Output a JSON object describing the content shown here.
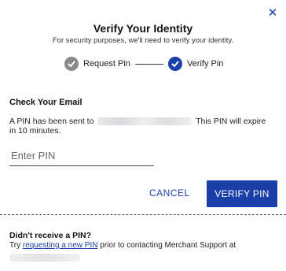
{
  "dialog": {
    "title": "Verify Your Identity",
    "subtitle": "For security purposes, we'll need to verify your identity.",
    "close_icon": "close-icon"
  },
  "steps": [
    {
      "label": "Request Pin",
      "state": "done",
      "icon": "check-circle-icon"
    },
    {
      "label": "Verify Pin",
      "state": "active",
      "icon": "check-circle-icon"
    }
  ],
  "colors": {
    "accent": "#1a3fa8",
    "step_done": "#8a8a8a"
  },
  "email_section": {
    "title": "Check Your Email",
    "message_prefix": "A PIN has been sent to",
    "message_suffix": "This PIN will expire in 10 minutes."
  },
  "pin_field": {
    "placeholder": "Enter PIN",
    "value": ""
  },
  "actions": {
    "cancel_label": "CANCEL",
    "verify_label": "VERIFY PIN"
  },
  "footer": {
    "title": "Didn't receive a PIN?",
    "text_before": "Try",
    "link_label": "requesting a new PIN",
    "text_after": "prior to contacting Merchant Support at"
  }
}
